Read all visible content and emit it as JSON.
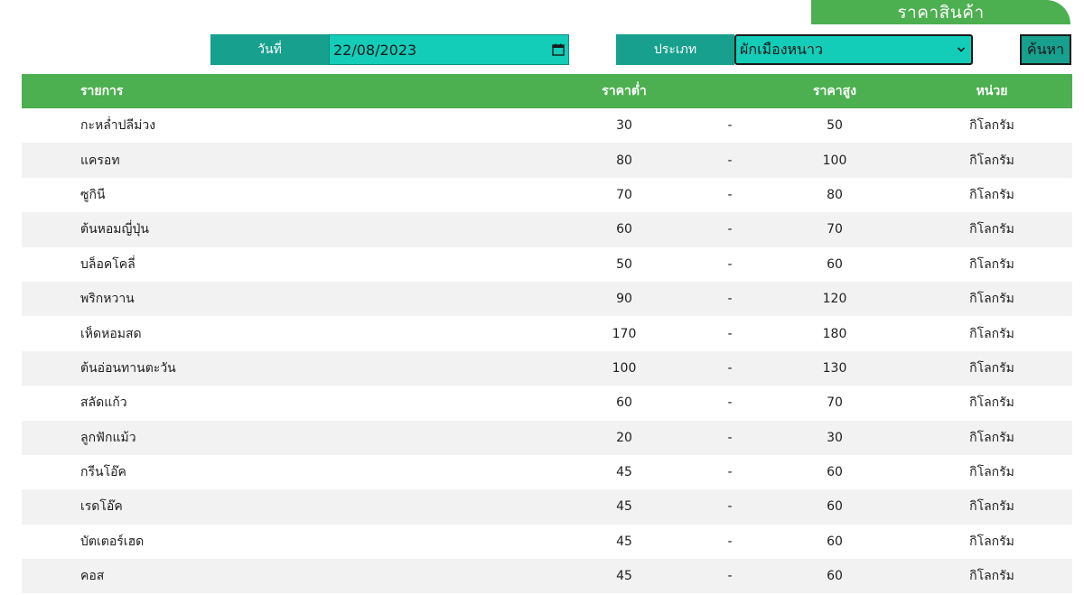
{
  "header": {
    "title": "ราคาสินค้า"
  },
  "filters": {
    "date_label": "วันที่",
    "date_value": "22/08/2023",
    "type_label": "ประเภท",
    "type_value": "ผักเมืองหนาว",
    "search_label": "ค้นหา"
  },
  "table": {
    "columns": {
      "name": "รายการ",
      "low": "ราคาต่ำ",
      "high": "ราคาสูง",
      "unit": "หน่วย"
    },
    "separator": "-",
    "rows": [
      {
        "name": "กะหล่ำปลีม่วง",
        "low": "30",
        "high": "50",
        "unit": "กิโลกรัม"
      },
      {
        "name": "แครอท",
        "low": "80",
        "high": "100",
        "unit": "กิโลกรัม"
      },
      {
        "name": "ซูกินี",
        "low": "70",
        "high": "80",
        "unit": "กิโลกรัม"
      },
      {
        "name": "ต้นหอมญี่ปุ่น",
        "low": "60",
        "high": "70",
        "unit": "กิโลกรัม"
      },
      {
        "name": "บล็อคโคลี่",
        "low": "50",
        "high": "60",
        "unit": "กิโลกรัม"
      },
      {
        "name": "พริกหวาน",
        "low": "90",
        "high": "120",
        "unit": "กิโลกรัม"
      },
      {
        "name": "เห็ดหอมสด",
        "low": "170",
        "high": "180",
        "unit": "กิโลกรัม"
      },
      {
        "name": "ต้นอ่อนทานตะวัน",
        "low": "100",
        "high": "130",
        "unit": "กิโลกรัม"
      },
      {
        "name": "สลัดแก้ว",
        "low": "60",
        "high": "70",
        "unit": "กิโลกรัม"
      },
      {
        "name": "ลูกฟักแม้ว",
        "low": "20",
        "high": "30",
        "unit": "กิโลกรัม"
      },
      {
        "name": "กรีนโอ๊ค",
        "low": "45",
        "high": "60",
        "unit": "กิโลกรัม"
      },
      {
        "name": "เรดโอ๊ค",
        "low": "45",
        "high": "60",
        "unit": "กิโลกรัม"
      },
      {
        "name": "บัตเตอร์เฮด",
        "low": "45",
        "high": "60",
        "unit": "กิโลกรัม"
      },
      {
        "name": "คอส",
        "low": "45",
        "high": "60",
        "unit": "กิโลกรัม"
      }
    ]
  },
  "colors": {
    "header_green": "#4caf50",
    "teal_label": "#17a08e",
    "teal_input": "#13cdb9",
    "row_alt": "#f2f2f2"
  }
}
